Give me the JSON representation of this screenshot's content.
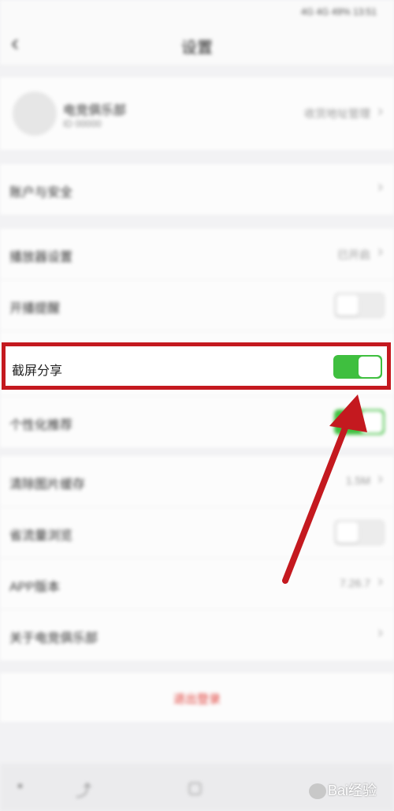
{
  "status_bar": {
    "right_text": "4G 4G 49% 13:51"
  },
  "nav": {
    "title": "设置",
    "back_icon": "chevron-left-icon"
  },
  "profile": {
    "name": "电竞俱乐部",
    "subtitle": "ID 00000",
    "right_text": "收货地址管理"
  },
  "account_row": {
    "label": "账户与安全"
  },
  "section2": {
    "rows": [
      {
        "label": "播放器设置",
        "value": "已开启"
      },
      {
        "label": "开播提醒"
      }
    ]
  },
  "highlight": {
    "label": "截屏分享",
    "toggle_on": true,
    "border_color": "#c4191f",
    "toggle_color": "#3fbf3f"
  },
  "personalized_row": {
    "label": "个性化推荐"
  },
  "section3": {
    "rows": [
      {
        "label": "清除图片缓存",
        "value": "1.5M"
      },
      {
        "label": "省流量浏览"
      },
      {
        "label": "APP版本",
        "value": "7.26.7"
      },
      {
        "label": "关于电竞俱乐部"
      }
    ]
  },
  "logout": {
    "label": "退出登录",
    "color": "#e0403a"
  },
  "bottom_bar": {
    "icons": [
      "back-icon",
      "recent-icon",
      "home-icon",
      "menu-icon"
    ]
  },
  "watermark": {
    "text": "Bai经验"
  }
}
